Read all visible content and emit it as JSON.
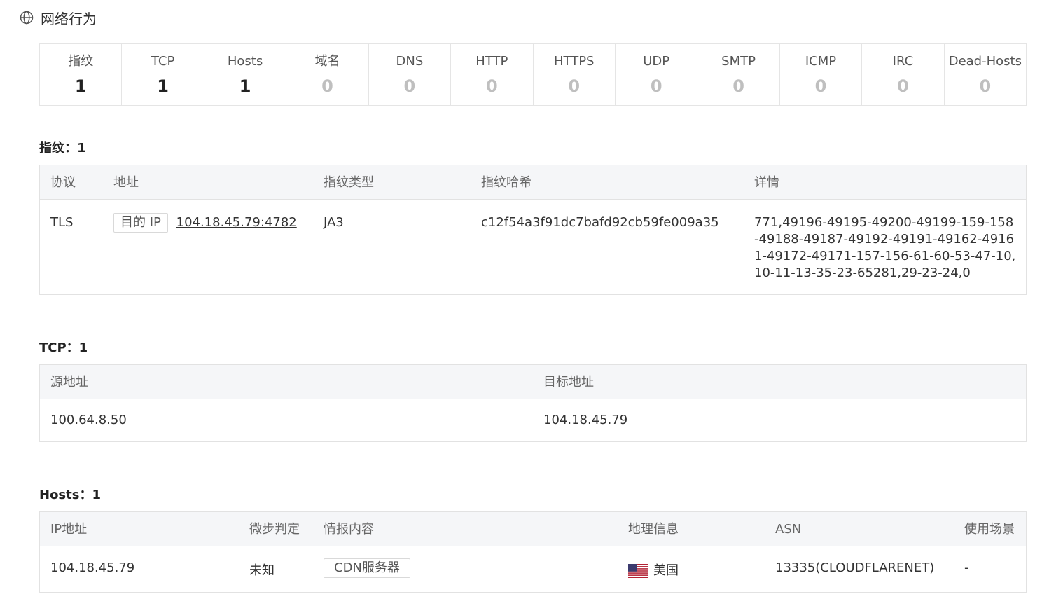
{
  "header": {
    "title": "网络行为",
    "icon": "globe-icon"
  },
  "stats": [
    {
      "label": "指纹",
      "value": "1"
    },
    {
      "label": "TCP",
      "value": "1"
    },
    {
      "label": "Hosts",
      "value": "1"
    },
    {
      "label": "域名",
      "value": "0"
    },
    {
      "label": "DNS",
      "value": "0"
    },
    {
      "label": "HTTP",
      "value": "0"
    },
    {
      "label": "HTTPS",
      "value": "0"
    },
    {
      "label": "UDP",
      "value": "0"
    },
    {
      "label": "SMTP",
      "value": "0"
    },
    {
      "label": "ICMP",
      "value": "0"
    },
    {
      "label": "IRC",
      "value": "0"
    },
    {
      "label": "Dead-Hosts",
      "value": "0"
    }
  ],
  "fingerprint": {
    "title": "指纹：1",
    "columns": [
      "协议",
      "地址",
      "指纹类型",
      "指纹哈希",
      "详情"
    ],
    "rows": [
      {
        "protocol": "TLS",
        "address_tag": "目的 IP",
        "address": "104.18.45.79:4782",
        "type": "JA3",
        "hash": "c12f54a3f91dc7bafd92cb59fe009a35",
        "details": "771,49196-49195-49200-49199-159-158-49188-49187-49192-49191-49162-49161-49172-49171-157-156-61-60-53-47-10,10-11-13-35-23-65281,29-23-24,0"
      }
    ]
  },
  "tcp": {
    "title": "TCP：1",
    "columns": [
      "源地址",
      "目标地址"
    ],
    "rows": [
      {
        "src": "100.64.8.50",
        "dst": "104.18.45.79"
      }
    ]
  },
  "hosts": {
    "title": "Hosts：1",
    "columns": [
      "IP地址",
      "微步判定",
      "情报内容",
      "地理信息",
      "ASN",
      "使用场景"
    ],
    "rows": [
      {
        "ip": "104.18.45.79",
        "verdict": "未知",
        "intel_tag": "CDN服务器",
        "geo": "美国",
        "geo_icon": "us-flag-icon",
        "asn": "13335(CLOUDFLARENET)",
        "usage": "-"
      }
    ]
  },
  "colors": {
    "zero_value": "#bfbfbf",
    "unknown_verdict": "#b0a68a",
    "table_header_bg": "#f5f6f8"
  }
}
